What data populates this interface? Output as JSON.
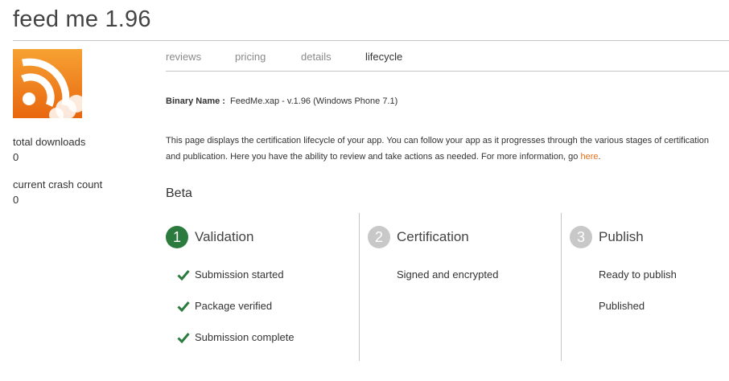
{
  "app": {
    "title": "feed me 1.96"
  },
  "stats": {
    "total_downloads_label": "total downloads",
    "total_downloads_value": "0",
    "crash_count_label": "current crash count",
    "crash_count_value": "0"
  },
  "tabs": [
    {
      "label": "reviews",
      "active": false
    },
    {
      "label": "pricing",
      "active": false
    },
    {
      "label": "details",
      "active": false
    },
    {
      "label": "lifecycle",
      "active": true
    }
  ],
  "binary": {
    "label": "Binary Name :",
    "value": "FeedMe.xap - v.1.96 (Windows Phone 7.1)"
  },
  "description": {
    "text": "This page displays the certification lifecycle of your app. You can follow your app as it progresses through the various stages of certification and publication. Here you have the ability to review and take actions as needed. For more information, go ",
    "link_text": "here",
    "tail": "."
  },
  "section": {
    "heading": "Beta"
  },
  "stages": [
    {
      "number": "1",
      "title": "Validation",
      "status": "active",
      "steps": [
        {
          "label": "Submission started",
          "done": true
        },
        {
          "label": "Package verified",
          "done": true
        },
        {
          "label": "Submission complete",
          "done": true
        }
      ]
    },
    {
      "number": "2",
      "title": "Certification",
      "status": "pending",
      "steps": [
        {
          "label": "Signed and encrypted",
          "done": false
        }
      ]
    },
    {
      "number": "3",
      "title": "Publish",
      "status": "pending",
      "steps": [
        {
          "label": "Ready to publish",
          "done": false
        },
        {
          "label": "Published",
          "done": false
        }
      ]
    }
  ],
  "colors": {
    "active_stage": "#2c7b3e",
    "pending_stage": "#c8c8c8",
    "check": "#2c7b3e",
    "link": "#e36f1e",
    "rss_orange": "#f08a1c"
  },
  "icons": {
    "app": "rss-feed-icon",
    "check": "checkmark-icon"
  }
}
